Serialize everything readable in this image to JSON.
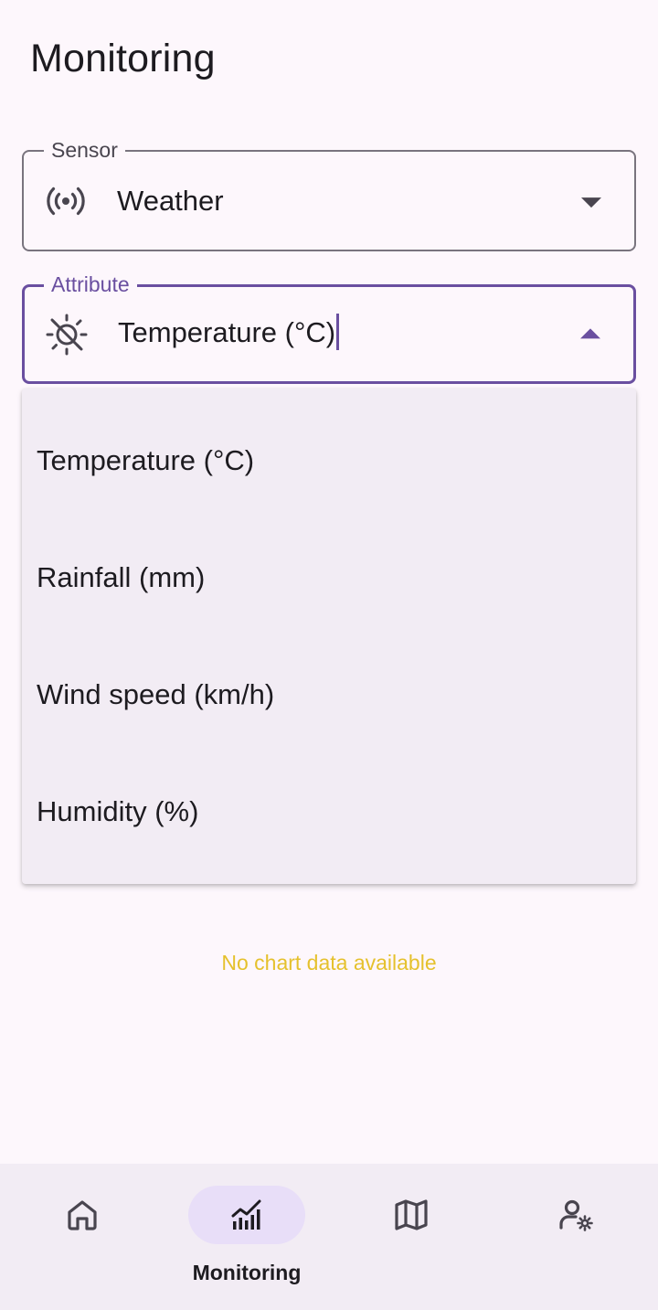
{
  "header": {
    "title": "Monitoring"
  },
  "sensor_field": {
    "label": "Sensor",
    "value": "Weather",
    "icon": "sensors-icon"
  },
  "attribute_field": {
    "label": "Attribute",
    "value": "Temperature (°C)",
    "icon": "sun-moon-icon",
    "expanded": true
  },
  "attribute_menu": {
    "options": [
      "Temperature (°C)",
      "Rainfall (mm)",
      "Wind speed (km/h)",
      "Humidity (%)"
    ]
  },
  "chart_placeholder": {
    "text": "No chart data available"
  },
  "bottom_nav": {
    "items": [
      {
        "icon": "home-icon",
        "label": ""
      },
      {
        "icon": "monitoring-chart-icon",
        "label": "Monitoring",
        "active": true
      },
      {
        "icon": "map-icon",
        "label": ""
      },
      {
        "icon": "user-settings-icon",
        "label": ""
      }
    ]
  },
  "colors": {
    "background": "#fdf7fc",
    "primary": "#6a4fa0",
    "outline": "#79747e",
    "menu_surface": "#f2ecf4",
    "nav_active_pill": "#e8def8",
    "empty_text": "#e5c12d"
  }
}
